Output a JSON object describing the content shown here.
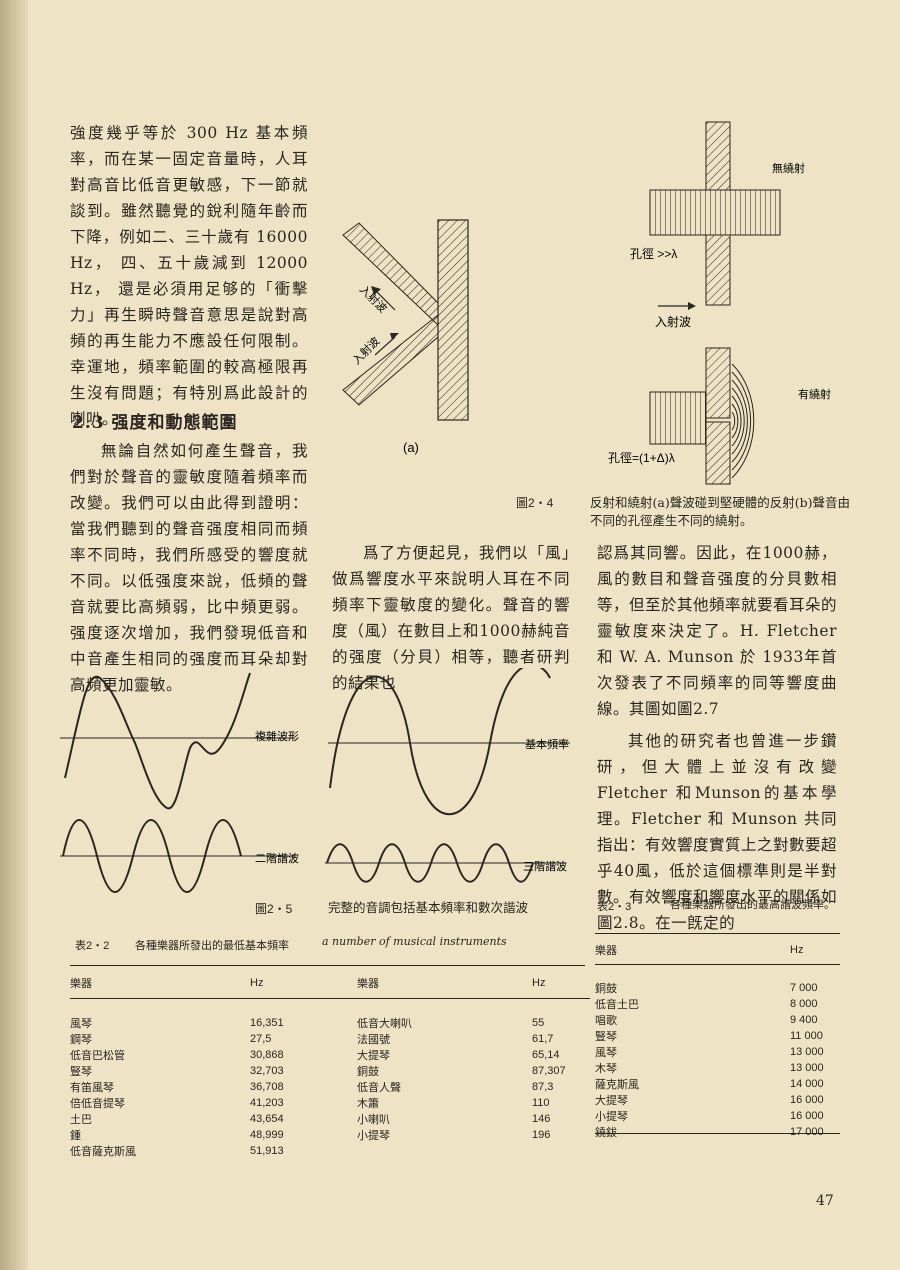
{
  "left_column_text": "強度幾乎等於 300 Hz 基本頻率，而在某一固定音量時，人耳對高音比低音更敏感，下一節就談到。雖然聽覺的銳利隨年齡而下降，例如二、三十歲有 16000 Hz， 四、五十歲減到 12000 Hz， 還是必須用足够的「衝擊力」再生瞬時聲音意思是說對高頻的再生能力不應設任何限制。幸運地，頻率範圍的較高極限再生沒有問題；有特別爲此設計的喇叭。",
  "section_title": "2.3 强度和動態範圍",
  "section_para": "無論自然如何產生聲音，我們對於聲音的靈敏度隨着頻率而改變。我們可以由此得到證明：當我們聽到的聲音强度相同而頻率不同時，我們所感受的響度就不同。以低强度來說，低頻的聲音就要比高頻弱，比中頻更弱。强度逐次增加，我們發現低音和中音產生相同的强度而耳朵却對高頻更加靈敏。",
  "middle_para": "爲了方便起見，我們以「風」做爲響度水平來說明人耳在不同頻率下靈敏度的變化。聲音的響度（風）在數目上和1000赫純音的强度（分貝）相等，聽者研判的結果也",
  "right_para1": "認爲其同響。因此，在1000赫，風的數目和聲音强度的分貝數相等，但至於其他頻率就要看耳朵的靈敏度來決定了。H. Fletcher 和 W. A. Munson 於 1933年首次發表了不同頻率的同等響度曲線。其圖如圖2.7",
  "right_para2": "其他的研究者也曾進一步鑽研，但大體上並沒有改變 Fletcher 和Munson的基本學理。Fletcher 和 Munson 共同指出：有效響度實質上之對數要超乎40風，低於這個標準則是半對數。有效響度和響度水平的關係如圖2.8。在一旣定的",
  "fig24": {
    "label_incident_1": "入射波",
    "label_incident_2": "入射波",
    "sub_a": "(a)",
    "label_no_diffraction": "無繞射",
    "label_aperture_large": "孔徑 >>λ",
    "label_incident_wave": "入射波",
    "label_diffraction": "有繞射",
    "label_aperture_close": "孔徑=(1+Δ)λ",
    "number": "圖2・4",
    "caption": "反射和繞射(a)聲波碰到堅硬體的反射(b)聲音由不同的孔徑產生不同的繞射。"
  },
  "fig25": {
    "label_complex": "複雜波形",
    "label_fundamental": "基本頻率",
    "label_second": "二階諧波",
    "label_third": "三階諧波",
    "number": "圖2・5",
    "caption": "完整的音調包括基本頻率和數次諧波"
  },
  "table22": {
    "number": "表2・2",
    "title": "各種樂器所發出的最低基本頻率",
    "title_en": "a number of musical instruments",
    "headers": [
      "樂器",
      "Hz",
      "樂器",
      "Hz"
    ],
    "left_rows": [
      [
        "風琴",
        "16,351"
      ],
      [
        "鋼琴",
        "27,5"
      ],
      [
        "低音巴松管",
        "30,868"
      ],
      [
        "豎琴",
        "32,703"
      ],
      [
        "有笛風琴",
        "36,708"
      ],
      [
        "倍低音提琴",
        "41,203"
      ],
      [
        "土巴",
        "43,654"
      ],
      [
        "鍾",
        "48,999"
      ],
      [
        "低音薩克斯風",
        "51,913"
      ]
    ],
    "right_rows": [
      [
        "低音大喇叭",
        "55"
      ],
      [
        "法國號",
        "61,7"
      ],
      [
        "大提琴",
        "65,14"
      ],
      [
        "銅鼓",
        "87,307"
      ],
      [
        "低音人聲",
        "87,3"
      ],
      [
        "木簫",
        "110"
      ],
      [
        "小喇叭",
        "146"
      ],
      [
        "小提琴",
        "196"
      ]
    ]
  },
  "table23": {
    "number": "表2・3",
    "title": "各種樂器所發出的最高諧波頻率。",
    "headers": [
      "樂器",
      "Hz"
    ],
    "rows": [
      [
        "銅鼓",
        "7 000"
      ],
      [
        "低音土巴",
        "8 000"
      ],
      [
        "唱歌",
        "9 400"
      ],
      [
        "豎琴",
        "11 000"
      ],
      [
        "風琴",
        "13 000"
      ],
      [
        "木琴",
        "13 000"
      ],
      [
        "薩克斯風",
        "14 000"
      ],
      [
        "大提琴",
        "16 000"
      ],
      [
        "小提琴",
        "16 000"
      ],
      [
        "鐃鈸",
        "17 000"
      ]
    ]
  },
  "page_number": "47"
}
